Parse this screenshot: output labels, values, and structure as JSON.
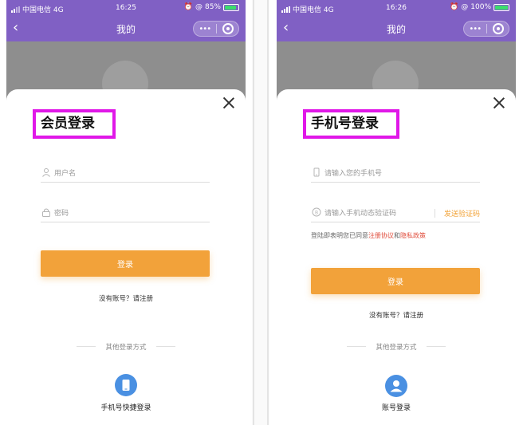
{
  "screens": [
    {
      "status": {
        "carrier": "中国电信 4G",
        "time": "16:25",
        "battery_text": "85%",
        "battery_level": 0.85
      },
      "nav": {
        "title": "我的"
      },
      "login_title": "会员登录",
      "fields": [
        {
          "placeholder": "用户名",
          "icon": "user-icon"
        },
        {
          "placeholder": "密码",
          "icon": "lock-icon"
        }
      ],
      "login_button": "登录",
      "register": "没有账号？请注册",
      "other_title": "其他登录方式",
      "alt_login": {
        "label": "手机号快捷登录",
        "icon": "phone-icon",
        "color": "#4a90e2"
      }
    },
    {
      "status": {
        "carrier": "中国电信 4G",
        "time": "16:26",
        "battery_text": "100%",
        "battery_level": 1.0
      },
      "nav": {
        "title": "我的"
      },
      "login_title": "手机号登录",
      "fields": [
        {
          "placeholder": "请输入您的手机号",
          "icon": "phone-icon"
        },
        {
          "placeholder": "请输入手机动态验证码",
          "icon": "shield-icon"
        }
      ],
      "send_code": "发送验证码",
      "agreement": {
        "prefix": "登陆即表明您已同意",
        "terms": "注册协议",
        "and": "和",
        "privacy": "隐私政策"
      },
      "login_button": "登录",
      "register": "没有账号？请注册",
      "other_title": "其他登录方式",
      "alt_login": {
        "label": "账号登录",
        "icon": "user-icon",
        "color": "#4a90e2"
      }
    }
  ],
  "colors": {
    "nav_purple": "#8060c4",
    "button_orange": "#f2a23a",
    "link_red": "#e04d3c",
    "highlight_magenta": "#e018e8"
  }
}
